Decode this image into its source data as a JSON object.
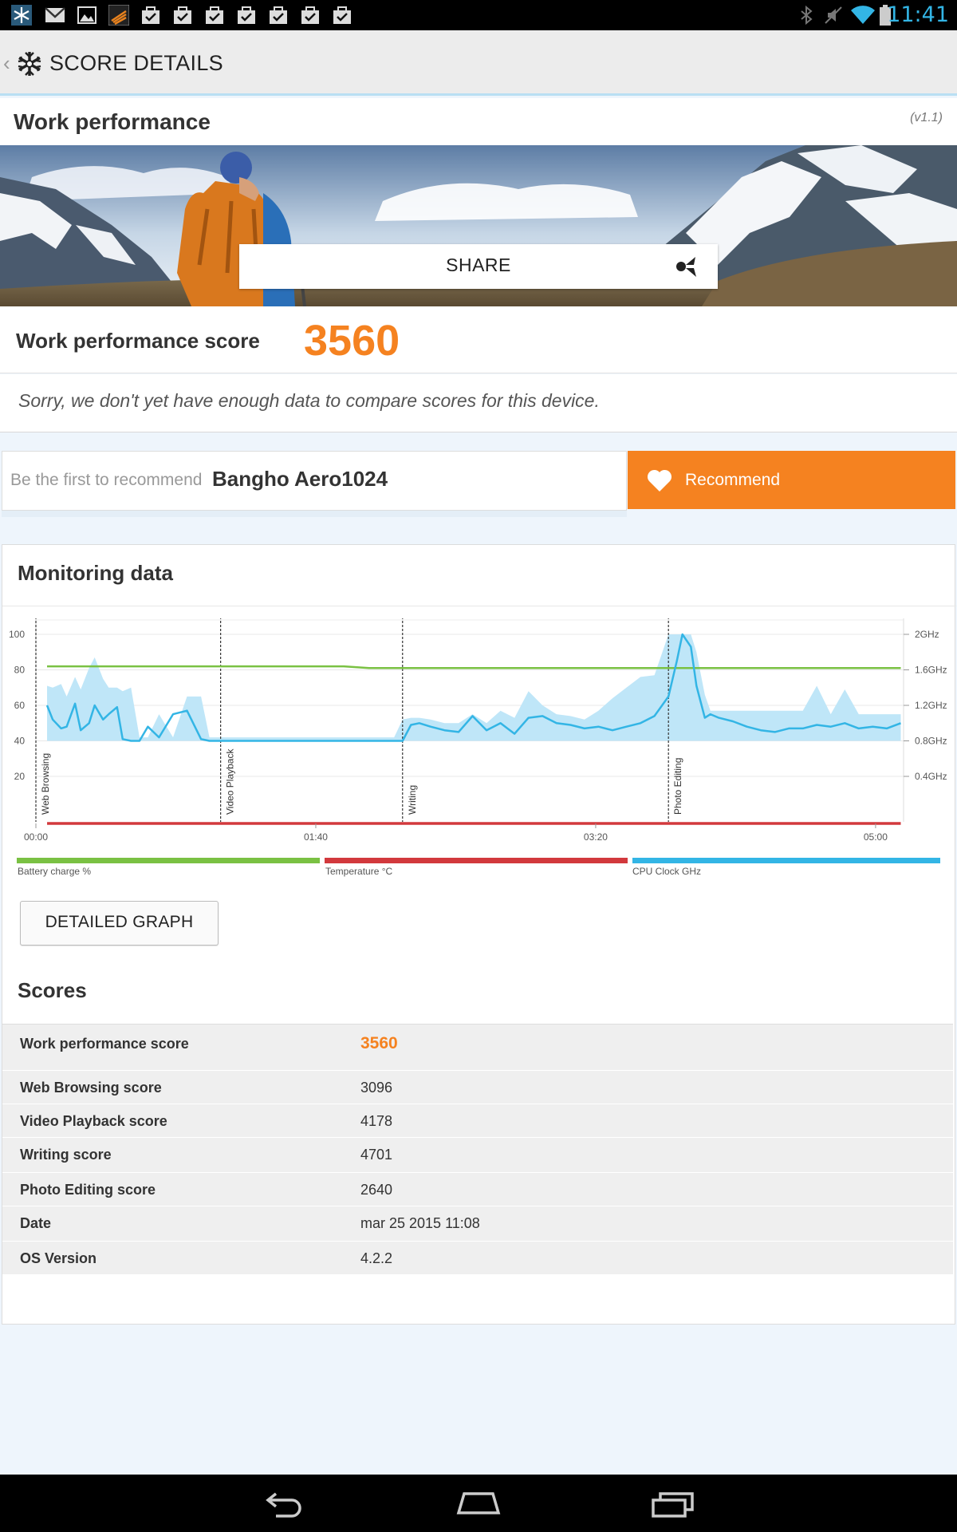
{
  "status_bar": {
    "time": "11:41",
    "notification_icons": [
      "snowflake-app-icon",
      "gmail-icon",
      "gallery-icon",
      "app-icon",
      "task-icon",
      "task-icon",
      "task-icon",
      "task-icon",
      "task-icon",
      "task-icon",
      "task-icon"
    ],
    "system_icons": [
      "bluetooth-icon",
      "mute-icon",
      "wifi-icon",
      "battery-icon"
    ]
  },
  "action_bar": {
    "title": "SCORE DETAILS"
  },
  "work_performance": {
    "title": "Work performance",
    "version": "(v1.1)",
    "share_label": "SHARE",
    "score_label": "Work performance score",
    "score_value": "3560",
    "sorry_text": "Sorry, we don't yet have enough data to compare scores for this device."
  },
  "recommend": {
    "prefix": "Be the first to recommend",
    "device": "Bangho Aero1024",
    "button_label": "Recommend"
  },
  "monitoring": {
    "title": "Monitoring data",
    "detail_button": "DETAILED GRAPH",
    "legend": [
      {
        "label": "Battery charge %",
        "color": "#7ac143"
      },
      {
        "label": "Temperature °C",
        "color": "#d2393d"
      },
      {
        "label": "CPU Clock GHz",
        "color": "#33b5e5"
      }
    ]
  },
  "chart_data": {
    "type": "line",
    "x_ticks": [
      "00:00",
      "01:40",
      "03:20",
      "05:00"
    ],
    "x_range_seconds": [
      0,
      310
    ],
    "y_left_ticks": [
      "100",
      "80",
      "60",
      "40",
      "20"
    ],
    "y_left_range": [
      0,
      100
    ],
    "y_right_ticks": [
      "2GHz",
      "1.6GHz",
      "1.2GHz",
      "0.8GHz",
      "0.4GHz"
    ],
    "y_right_range_ghz": [
      0,
      2.0
    ],
    "sections": [
      {
        "label": "Web Browsing",
        "start_seconds": 0
      },
      {
        "label": "Video Playback",
        "start_seconds": 66
      },
      {
        "label": "Writing",
        "start_seconds": 131
      },
      {
        "label": "Photo Editing",
        "start_seconds": 226
      }
    ],
    "series": [
      {
        "name": "Battery charge %",
        "color": "#7ac143",
        "x": [
          4,
          110,
          119,
          309
        ],
        "y": [
          82,
          82,
          81,
          81
        ]
      },
      {
        "name": "Temperature °C",
        "color": "#d2393d",
        "x": [
          4,
          309
        ],
        "y": [
          0,
          0
        ]
      },
      {
        "name": "CPU Clock GHz",
        "color": "#33b5e5",
        "x": [
          4,
          6,
          9,
          11,
          14,
          16,
          19,
          21,
          24,
          26,
          29,
          31,
          34,
          37,
          40,
          44,
          49,
          54,
          59,
          62,
          64,
          66,
          68,
          70,
          72,
          76,
          86,
          96,
          106,
          116,
          121,
          126,
          128,
          131,
          134,
          137,
          141,
          146,
          151,
          156,
          161,
          166,
          171,
          176,
          181,
          186,
          191,
          196,
          201,
          206,
          211,
          216,
          221,
          226,
          229,
          231,
          234,
          236,
          239,
          241,
          244,
          249,
          254,
          259,
          264,
          269,
          274,
          279,
          284,
          289,
          294,
          299,
          304,
          309
        ],
        "y": [
          1.2,
          1.04,
          0.94,
          0.96,
          1.22,
          0.92,
          1.0,
          1.2,
          1.04,
          1.1,
          1.18,
          0.82,
          0.8,
          0.8,
          0.96,
          0.84,
          1.1,
          1.14,
          0.82,
          0.8,
          0.8,
          0.8,
          0.8,
          0.8,
          0.8,
          0.8,
          0.8,
          0.8,
          0.8,
          0.8,
          0.8,
          0.8,
          0.8,
          0.8,
          0.98,
          1.0,
          0.96,
          0.92,
          0.9,
          1.08,
          0.92,
          1.0,
          0.88,
          1.06,
          1.08,
          1.0,
          0.98,
          0.94,
          0.96,
          0.92,
          0.96,
          1.0,
          1.08,
          1.3,
          1.7,
          2.0,
          1.86,
          1.42,
          1.06,
          1.1,
          1.06,
          1.02,
          0.96,
          0.92,
          0.9,
          0.94,
          0.94,
          0.98,
          0.96,
          1.0,
          0.94,
          0.96,
          0.94,
          1.0
        ],
        "band_upper": [
          1.42,
          1.4,
          1.44,
          1.3,
          1.52,
          1.38,
          1.62,
          1.74,
          1.5,
          1.4,
          1.4,
          1.36,
          1.4,
          0.84,
          0.84,
          1.1,
          0.84,
          1.3,
          1.3,
          0.84,
          0.84,
          0.84,
          0.84,
          0.84,
          0.84,
          0.84,
          0.84,
          0.84,
          0.84,
          0.84,
          0.84,
          0.84,
          0.84,
          1.04,
          1.06,
          1.06,
          1.04,
          1.0,
          1.0,
          1.1,
          1.0,
          1.14,
          1.06,
          1.36,
          1.2,
          1.1,
          1.08,
          1.04,
          1.14,
          1.28,
          1.4,
          1.52,
          1.54,
          2.0,
          2.0,
          2.0,
          2.0,
          1.8,
          1.32,
          1.14,
          1.14,
          1.14,
          1.14,
          1.14,
          1.14,
          1.14,
          1.14,
          1.42,
          1.1,
          1.38,
          1.1,
          1.1,
          1.1,
          1.1
        ],
        "band_lower": [
          0.8,
          0.8,
          0.8,
          0.8,
          0.8,
          0.8,
          0.8,
          0.8,
          0.8,
          0.8,
          0.8,
          0.8,
          0.8,
          0.8,
          0.8,
          0.8,
          0.8,
          0.8,
          0.8,
          0.8,
          0.8,
          0.8,
          0.8,
          0.8,
          0.8,
          0.8,
          0.8,
          0.8,
          0.8,
          0.8,
          0.8,
          0.8,
          0.8,
          0.8,
          0.8,
          0.8,
          0.8,
          0.8,
          0.8,
          0.8,
          0.8,
          0.8,
          0.8,
          0.8,
          0.8,
          0.8,
          0.8,
          0.8,
          0.8,
          0.8,
          0.8,
          0.8,
          0.8,
          0.8,
          0.8,
          0.8,
          0.8,
          0.8,
          0.8,
          0.8,
          0.8,
          0.8,
          0.8,
          0.8,
          0.8,
          0.8,
          0.8,
          0.8,
          0.8,
          0.8,
          0.8,
          0.8,
          0.8,
          0.8
        ]
      }
    ]
  },
  "scores": {
    "title": "Scores",
    "rows": [
      {
        "label": "Work performance score",
        "value": "3560"
      },
      {
        "label": "Web Browsing score",
        "value": "3096"
      },
      {
        "label": "Video Playback score",
        "value": "4178"
      },
      {
        "label": "Writing score",
        "value": "4701"
      },
      {
        "label": "Photo Editing score",
        "value": "2640"
      },
      {
        "label": "Date",
        "value": "mar 25 2015 11:08"
      },
      {
        "label": "OS Version",
        "value": "4.2.2"
      }
    ]
  },
  "nav_bar": {
    "icons": [
      "back-icon",
      "home-icon",
      "recent-apps-icon"
    ]
  }
}
